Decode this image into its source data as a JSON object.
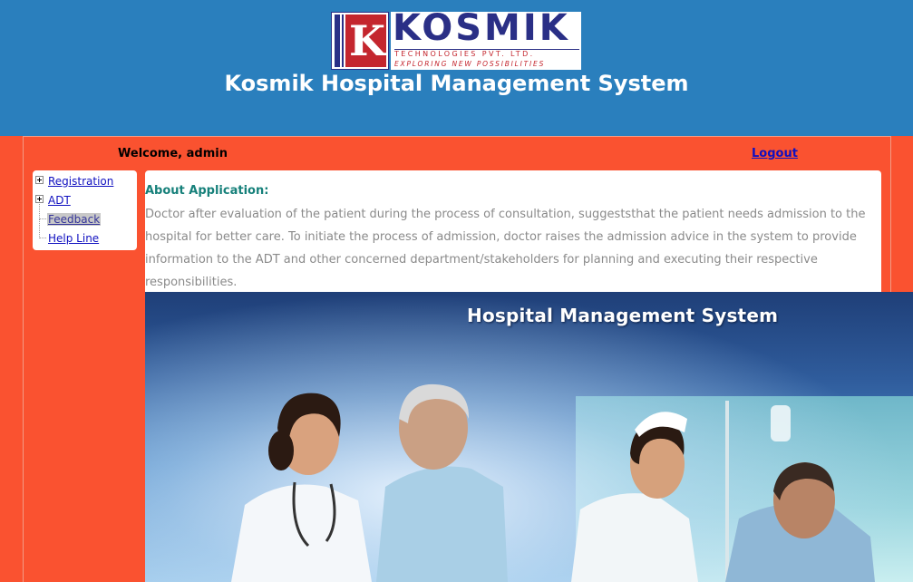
{
  "header": {
    "logo": {
      "name": "KOSMIK",
      "subtitle": "TECHNOLOGIES PVT. LTD.",
      "tagline": "EXPLORING NEW POSSIBILITIES"
    },
    "app_title": "Kosmik Hospital Management System"
  },
  "topbar": {
    "welcome": "Welcome, admin",
    "logout": "Logout"
  },
  "sidebar": {
    "items": [
      {
        "label": "Registration",
        "expandable": true
      },
      {
        "label": "ADT",
        "expandable": true
      },
      {
        "label": "Feedback",
        "expandable": false,
        "selected": true
      },
      {
        "label": "Help Line",
        "expandable": false
      }
    ]
  },
  "about": {
    "heading": "About Application:",
    "text": "Doctor after evaluation of the patient during the process of consultation, suggeststhat the patient needs admission to the hospital for better care. To initiate the process of admission, doctor raises the admission advice in the system to provide information to the ADT and other concerned department/stakeholders for planning and executing their respective responsibilities."
  },
  "banner": {
    "title": "Hospital Management System"
  },
  "colors": {
    "header_bg": "#2a7fbd",
    "page_bg": "#fa5230",
    "link": "#1010c0",
    "heading_teal": "#16807a"
  }
}
